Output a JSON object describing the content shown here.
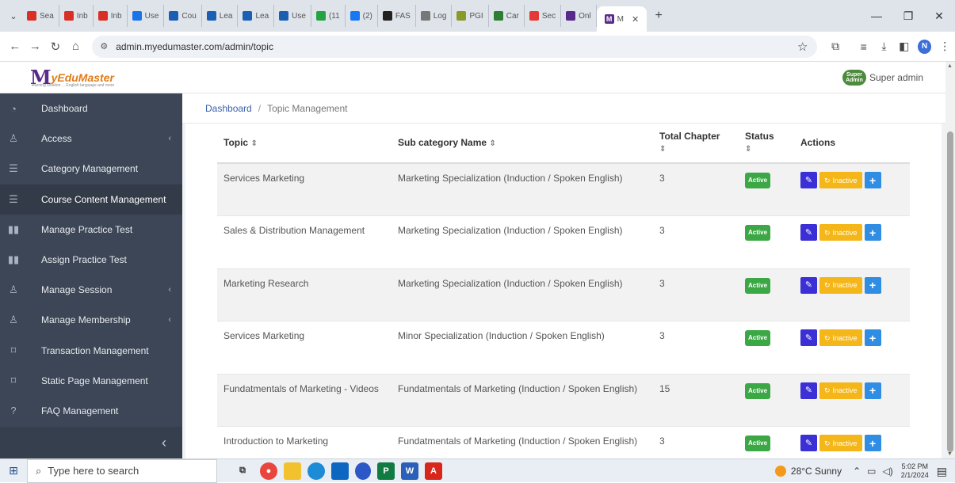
{
  "browser": {
    "tabs": [
      {
        "label": "Sea",
        "icon": "gmail-icon",
        "color": "#d93025"
      },
      {
        "label": "Inb",
        "icon": "gmail-icon",
        "color": "#d93025"
      },
      {
        "label": "Inb",
        "icon": "gmail-icon",
        "color": "#d93025"
      },
      {
        "label": "Use",
        "icon": "globe-icon",
        "color": "#1a73e8"
      },
      {
        "label": "Cou",
        "icon": "app-icon",
        "color": "#1a5fb4"
      },
      {
        "label": "Lea",
        "icon": "app-icon",
        "color": "#1a5fb4"
      },
      {
        "label": "Lea",
        "icon": "app-icon",
        "color": "#1a5fb4"
      },
      {
        "label": "Use",
        "icon": "app-icon",
        "color": "#1a5fb4"
      },
      {
        "label": "(11",
        "icon": "chat-icon",
        "color": "#25a244"
      },
      {
        "label": "(2)",
        "icon": "facebook-icon",
        "color": "#1877f2"
      },
      {
        "label": "FAS",
        "icon": "app-icon",
        "color": "#222222"
      },
      {
        "label": "Log",
        "icon": "app-icon",
        "color": "#777777"
      },
      {
        "label": "PGI",
        "icon": "app-icon",
        "color": "#8a9a2a"
      },
      {
        "label": "Car",
        "icon": "app-icon",
        "color": "#2e7d32"
      },
      {
        "label": "Sec",
        "icon": "youtube-icon",
        "color": "#e53935"
      },
      {
        "label": "Onl",
        "icon": "app-icon",
        "color": "#5a2a8a"
      }
    ],
    "active_tab": {
      "label": "M",
      "icon": "app-icon",
      "color": "#5a2a8a"
    },
    "new_tab": "+",
    "url": "admin.myedumaster.com/admin/topic",
    "profile_initial": "N"
  },
  "app": {
    "logo": {
      "mark": "M",
      "brand": "yEduMaster",
      "tagline": "learning solution ... English language and more"
    },
    "user": {
      "avatar_text": "Super Admin",
      "name": "Super admin"
    },
    "sidebar": [
      {
        "label": "Dashboard",
        "icon": "dashboard-icon",
        "glyph": "◔",
        "chevron": false
      },
      {
        "label": "Access",
        "icon": "user-icon",
        "glyph": "♙",
        "chevron": true
      },
      {
        "label": "Category Management",
        "icon": "list-icon",
        "glyph": "☰",
        "chevron": false
      },
      {
        "label": "Course Content Management",
        "icon": "list-icon",
        "glyph": "☰",
        "chevron": false,
        "active": true
      },
      {
        "label": "Manage Practice Test",
        "icon": "book-icon",
        "glyph": "▮▮",
        "chevron": false
      },
      {
        "label": "Assign Practice Test",
        "icon": "book-icon",
        "glyph": "▮▮",
        "chevron": false
      },
      {
        "label": "Manage Session",
        "icon": "user-icon",
        "glyph": "♙",
        "chevron": true
      },
      {
        "label": "Manage Membership",
        "icon": "user-icon",
        "glyph": "♙",
        "chevron": true
      },
      {
        "label": "Transaction Management",
        "icon": "bookmark-icon",
        "glyph": "⌑",
        "chevron": false
      },
      {
        "label": "Static Page Management",
        "icon": "bookmark-icon",
        "glyph": "⌑",
        "chevron": false
      },
      {
        "label": "FAQ Management",
        "icon": "question-icon",
        "glyph": "?",
        "chevron": false
      }
    ],
    "breadcrumb": {
      "root": "Dashboard",
      "separator": "/",
      "current": "Topic Management"
    },
    "table": {
      "headers": {
        "topic": "Topic",
        "subcategory": "Sub category Name",
        "chapters": "Total Chapter",
        "status": "Status",
        "actions": "Actions"
      },
      "sort_glyph": "⇕",
      "rows": [
        {
          "topic": "Services Marketing",
          "subcategory": "Marketing Specialization (Induction / Spoken English)",
          "chapters": "3",
          "status": "Active",
          "toggle": "Inactive"
        },
        {
          "topic": "Sales & Distribution Management",
          "subcategory": "Marketing Specialization (Induction / Spoken English)",
          "chapters": "3",
          "status": "Active",
          "toggle": "Inactive"
        },
        {
          "topic": "Marketing Research",
          "subcategory": "Marketing Specialization (Induction / Spoken English)",
          "chapters": "3",
          "status": "Active",
          "toggle": "Inactive"
        },
        {
          "topic": "Services Marketing",
          "subcategory": "Minor Specialization (Induction / Spoken English)",
          "chapters": "3",
          "status": "Active",
          "toggle": "Inactive"
        },
        {
          "topic": "Fundatmentals of Marketing - Videos",
          "subcategory": "Fundatmentals of Marketing (Induction / Spoken English)",
          "chapters": "15",
          "status": "Active",
          "toggle": "Inactive"
        },
        {
          "topic": "Introduction to Marketing",
          "subcategory": "Fundatmentals of Marketing (Induction / Spoken English)",
          "chapters": "3",
          "status": "Active",
          "toggle": "Inactive"
        }
      ]
    }
  },
  "taskbar": {
    "search_placeholder": "Type here to search",
    "weather": "28°C  Sunny",
    "time": "5:02 PM",
    "date": "2/1/2024"
  },
  "colors": {
    "sidebar": "#3c4656",
    "active_badge": "#3ca745",
    "edit_button": "#3b2fd6",
    "inactive_button": "#f4b619",
    "add_button": "#2f8de4"
  }
}
